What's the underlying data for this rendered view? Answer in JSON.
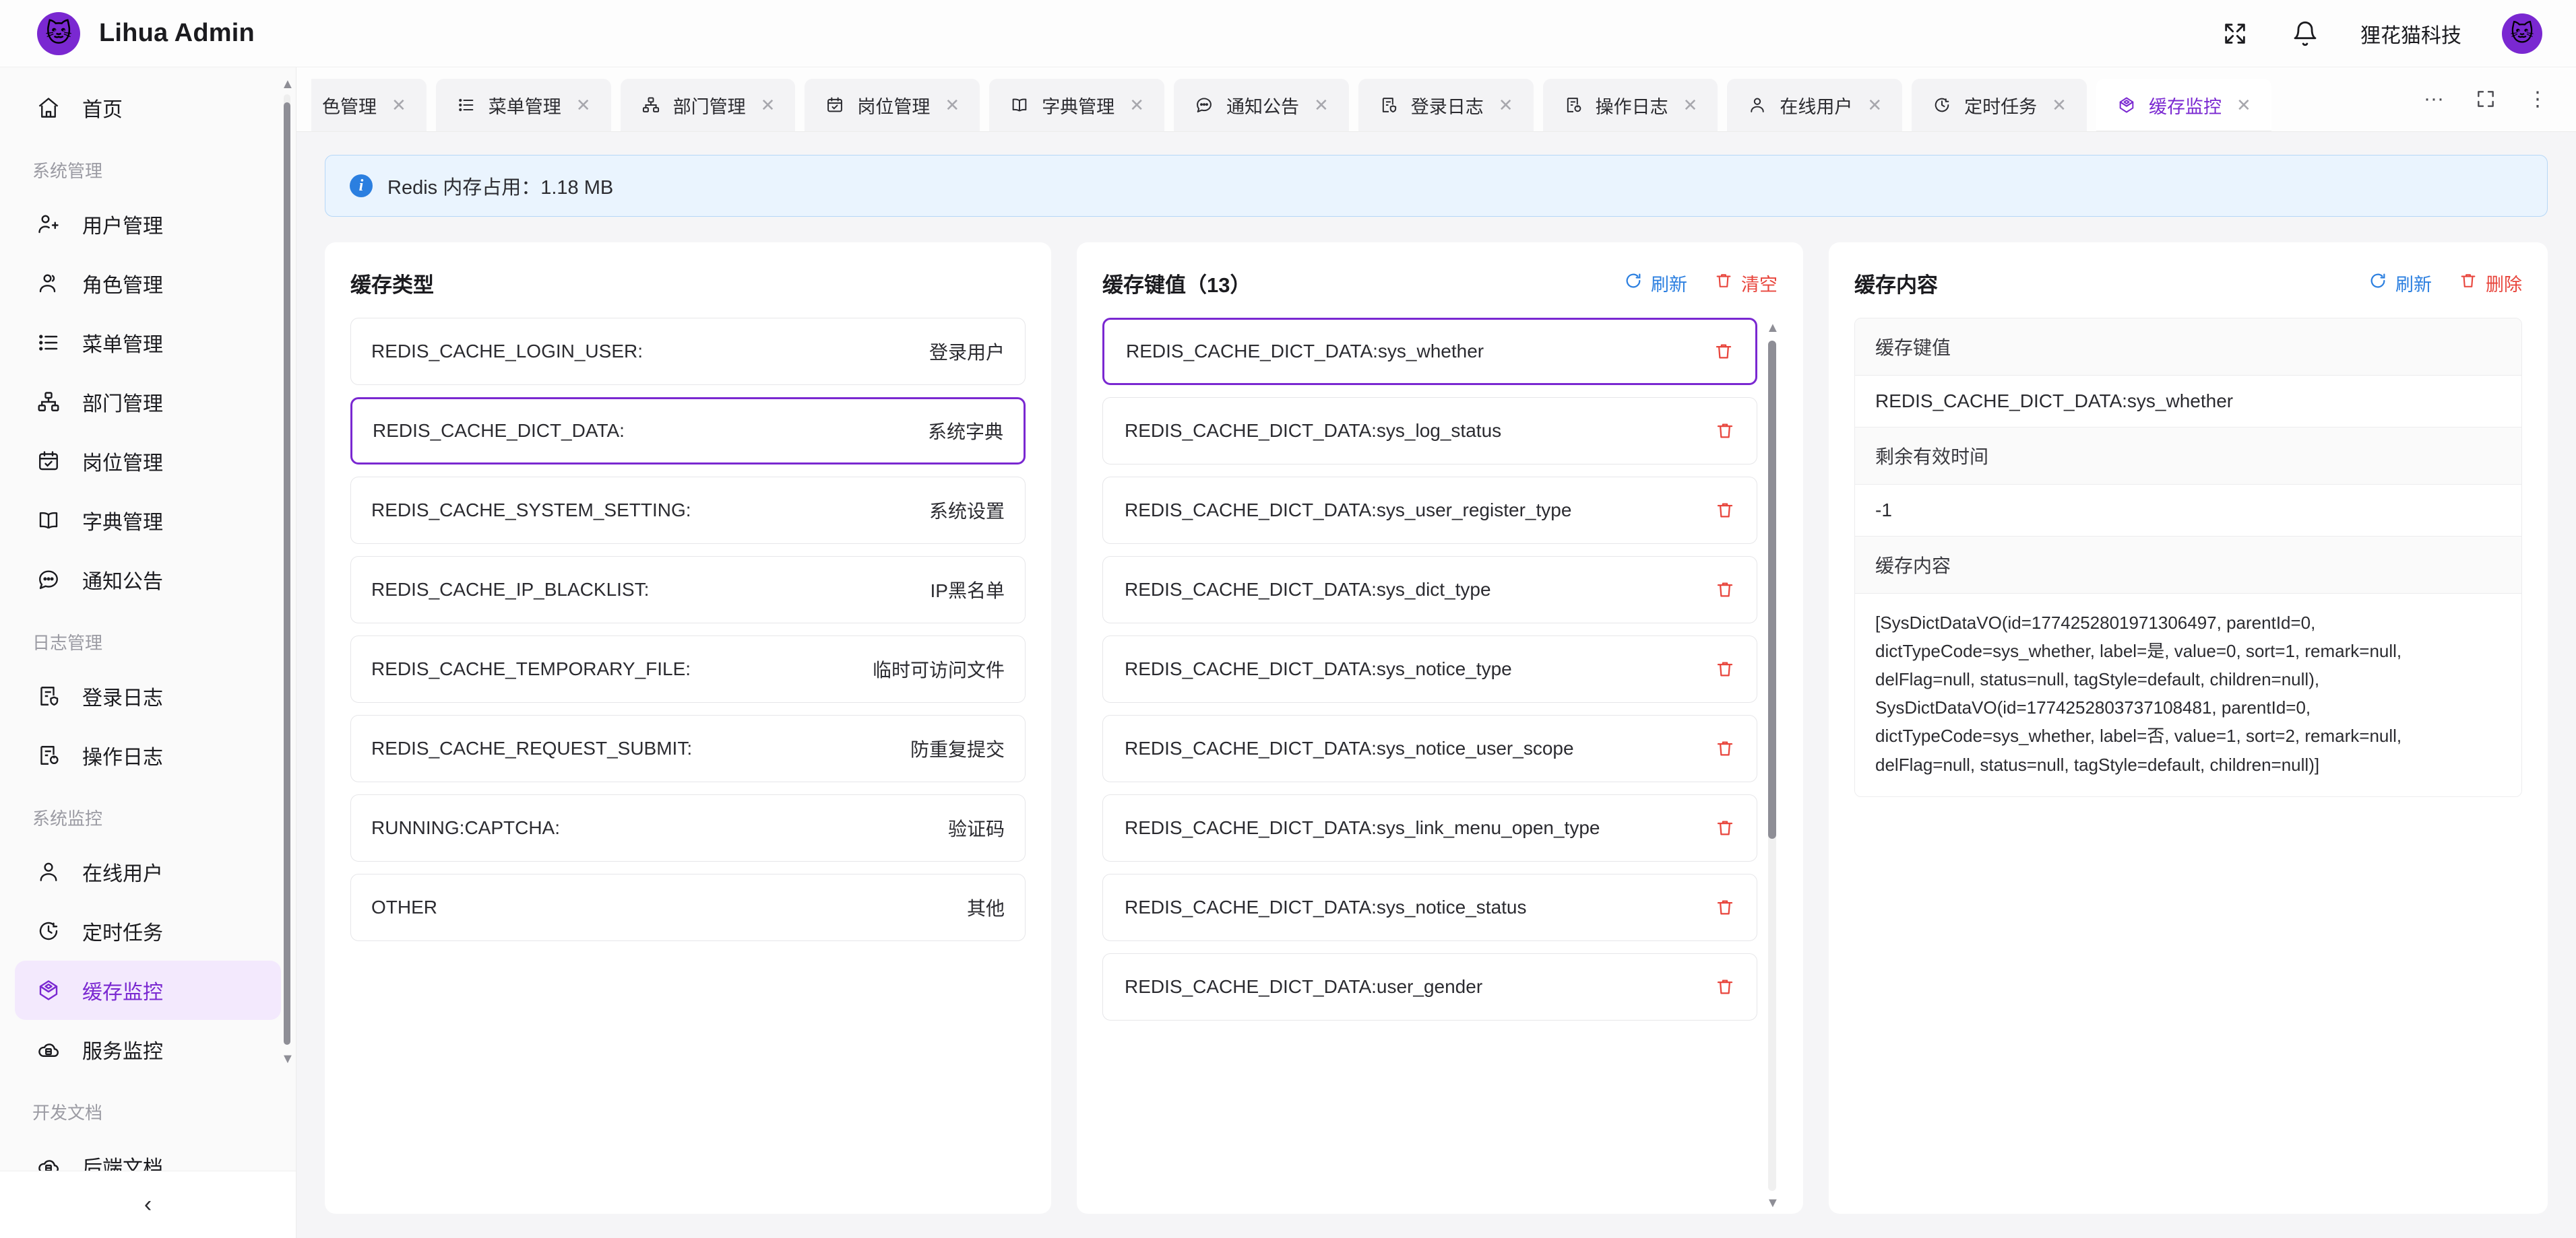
{
  "header": {
    "brand_title": "Lihua Admin",
    "logo_icon": "cat-logo-icon",
    "fullscreen_icon": "fullscreen-expand-icon",
    "bell_icon": "bell-icon",
    "user_name": "狸花猫科技",
    "avatar_icon": "cat-avatar-icon"
  },
  "sidebar": {
    "home": {
      "label": "首页",
      "icon": "home-icon"
    },
    "groups": [
      {
        "title": "系统管理",
        "items": [
          {
            "label": "用户管理",
            "icon": "user-add-icon",
            "active": false
          },
          {
            "label": "角色管理",
            "icon": "user-role-icon",
            "active": false
          },
          {
            "label": "菜单管理",
            "icon": "list-icon",
            "active": false
          },
          {
            "label": "部门管理",
            "icon": "org-tree-icon",
            "active": false
          },
          {
            "label": "岗位管理",
            "icon": "calendar-check-icon",
            "active": false
          },
          {
            "label": "字典管理",
            "icon": "book-icon",
            "active": false
          },
          {
            "label": "通知公告",
            "icon": "comment-dots-icon",
            "active": false
          }
        ]
      },
      {
        "title": "日志管理",
        "items": [
          {
            "label": "登录日志",
            "icon": "log-shield-icon",
            "active": false
          },
          {
            "label": "操作日志",
            "icon": "log-refresh-icon",
            "active": false
          }
        ]
      },
      {
        "title": "系统监控",
        "items": [
          {
            "label": "在线用户",
            "icon": "user-icon",
            "active": false
          },
          {
            "label": "定时任务",
            "icon": "clock-icon",
            "active": false
          },
          {
            "label": "缓存监控",
            "icon": "cube-icon",
            "active": true
          },
          {
            "label": "服务监控",
            "icon": "cloud-server-icon",
            "active": false
          }
        ]
      },
      {
        "title": "开发文档",
        "items": [
          {
            "label": "后端文档",
            "icon": "cloud-server-icon",
            "active": false
          }
        ]
      }
    ],
    "collapse_icon": "chevron-left-icon"
  },
  "tabbar": {
    "tabs": [
      {
        "label": "色管理",
        "icon": "",
        "active": false,
        "truncated": true
      },
      {
        "label": "菜单管理",
        "icon": "list-icon",
        "active": false
      },
      {
        "label": "部门管理",
        "icon": "org-tree-icon",
        "active": false
      },
      {
        "label": "岗位管理",
        "icon": "calendar-check-icon",
        "active": false
      },
      {
        "label": "字典管理",
        "icon": "book-icon",
        "active": false
      },
      {
        "label": "通知公告",
        "icon": "comment-dots-icon",
        "active": false
      },
      {
        "label": "登录日志",
        "icon": "log-shield-icon",
        "active": false
      },
      {
        "label": "操作日志",
        "icon": "log-refresh-icon",
        "active": false
      },
      {
        "label": "在线用户",
        "icon": "user-icon",
        "active": false
      },
      {
        "label": "定时任务",
        "icon": "clock-icon",
        "active": false
      },
      {
        "label": "缓存监控",
        "icon": "cube-icon",
        "active": true
      }
    ],
    "close_glyph": "✕",
    "actions": [
      {
        "name": "more-tabs-icon",
        "glyph": "···"
      },
      {
        "name": "fullscreen-icon",
        "glyph": "⛶"
      },
      {
        "name": "tab-menu-icon",
        "glyph": "⋮"
      }
    ]
  },
  "alert": {
    "icon": "info-circle-icon",
    "icon_glyph": "i",
    "text": "Redis 内存占用：1.18 MB"
  },
  "cache_types": {
    "title": "缓存类型",
    "rows": [
      {
        "key": "REDIS_CACHE_LOGIN_USER:",
        "value": "登录用户",
        "selected": false
      },
      {
        "key": "REDIS_CACHE_DICT_DATA:",
        "value": "系统字典",
        "selected": true
      },
      {
        "key": "REDIS_CACHE_SYSTEM_SETTING:",
        "value": "系统设置",
        "selected": false
      },
      {
        "key": "REDIS_CACHE_IP_BLACKLIST:",
        "value": "IP黑名单",
        "selected": false
      },
      {
        "key": "REDIS_CACHE_TEMPORARY_FILE:",
        "value": "临时可访问文件",
        "selected": false
      },
      {
        "key": "REDIS_CACHE_REQUEST_SUBMIT:",
        "value": "防重复提交",
        "selected": false
      },
      {
        "key": "RUNNING:CAPTCHA:",
        "value": "验证码",
        "selected": false
      },
      {
        "key": "OTHER",
        "value": "其他",
        "selected": false
      }
    ]
  },
  "cache_keys": {
    "title": "缓存键值（13）",
    "refresh_label": "刷新",
    "clear_label": "清空",
    "refresh_icon": "refresh-icon",
    "clear_icon": "trash-icon",
    "delete_icon": "trash-icon",
    "rows": [
      {
        "key": "REDIS_CACHE_DICT_DATA:sys_whether",
        "selected": true
      },
      {
        "key": "REDIS_CACHE_DICT_DATA:sys_log_status",
        "selected": false
      },
      {
        "key": "REDIS_CACHE_DICT_DATA:sys_user_register_type",
        "selected": false
      },
      {
        "key": "REDIS_CACHE_DICT_DATA:sys_dict_type",
        "selected": false
      },
      {
        "key": "REDIS_CACHE_DICT_DATA:sys_notice_type",
        "selected": false
      },
      {
        "key": "REDIS_CACHE_DICT_DATA:sys_notice_user_scope",
        "selected": false
      },
      {
        "key": "REDIS_CACHE_DICT_DATA:sys_link_menu_open_type",
        "selected": false
      },
      {
        "key": "REDIS_CACHE_DICT_DATA:sys_notice_status",
        "selected": false
      },
      {
        "key": "REDIS_CACHE_DICT_DATA:user_gender",
        "selected": false
      }
    ]
  },
  "cache_content": {
    "title": "缓存内容",
    "refresh_label": "刷新",
    "delete_label": "删除",
    "refresh_icon": "refresh-icon",
    "delete_icon": "trash-icon",
    "field_key_label": "缓存键值",
    "field_key_value": "REDIS_CACHE_DICT_DATA:sys_whether",
    "field_ttl_label": "剩余有效时间",
    "field_ttl_value": "-1",
    "field_content_label": "缓存内容",
    "field_content_value": "[SysDictDataVO(id=1774252801971306497, parentId=0, dictTypeCode=sys_whether, label=是, value=0, sort=1, remark=null, delFlag=null, status=null, tagStyle=default, children=null), SysDictDataVO(id=1774252803737108481, parentId=0, dictTypeCode=sys_whether, label=否, value=1, sort=2, remark=null, delFlag=null, status=null, tagStyle=default, children=null)]"
  },
  "colors": {
    "accent": "#7a28d1",
    "info": "#2b7fe0",
    "danger": "#e8453c",
    "page_bg": "#f5f5f7"
  }
}
